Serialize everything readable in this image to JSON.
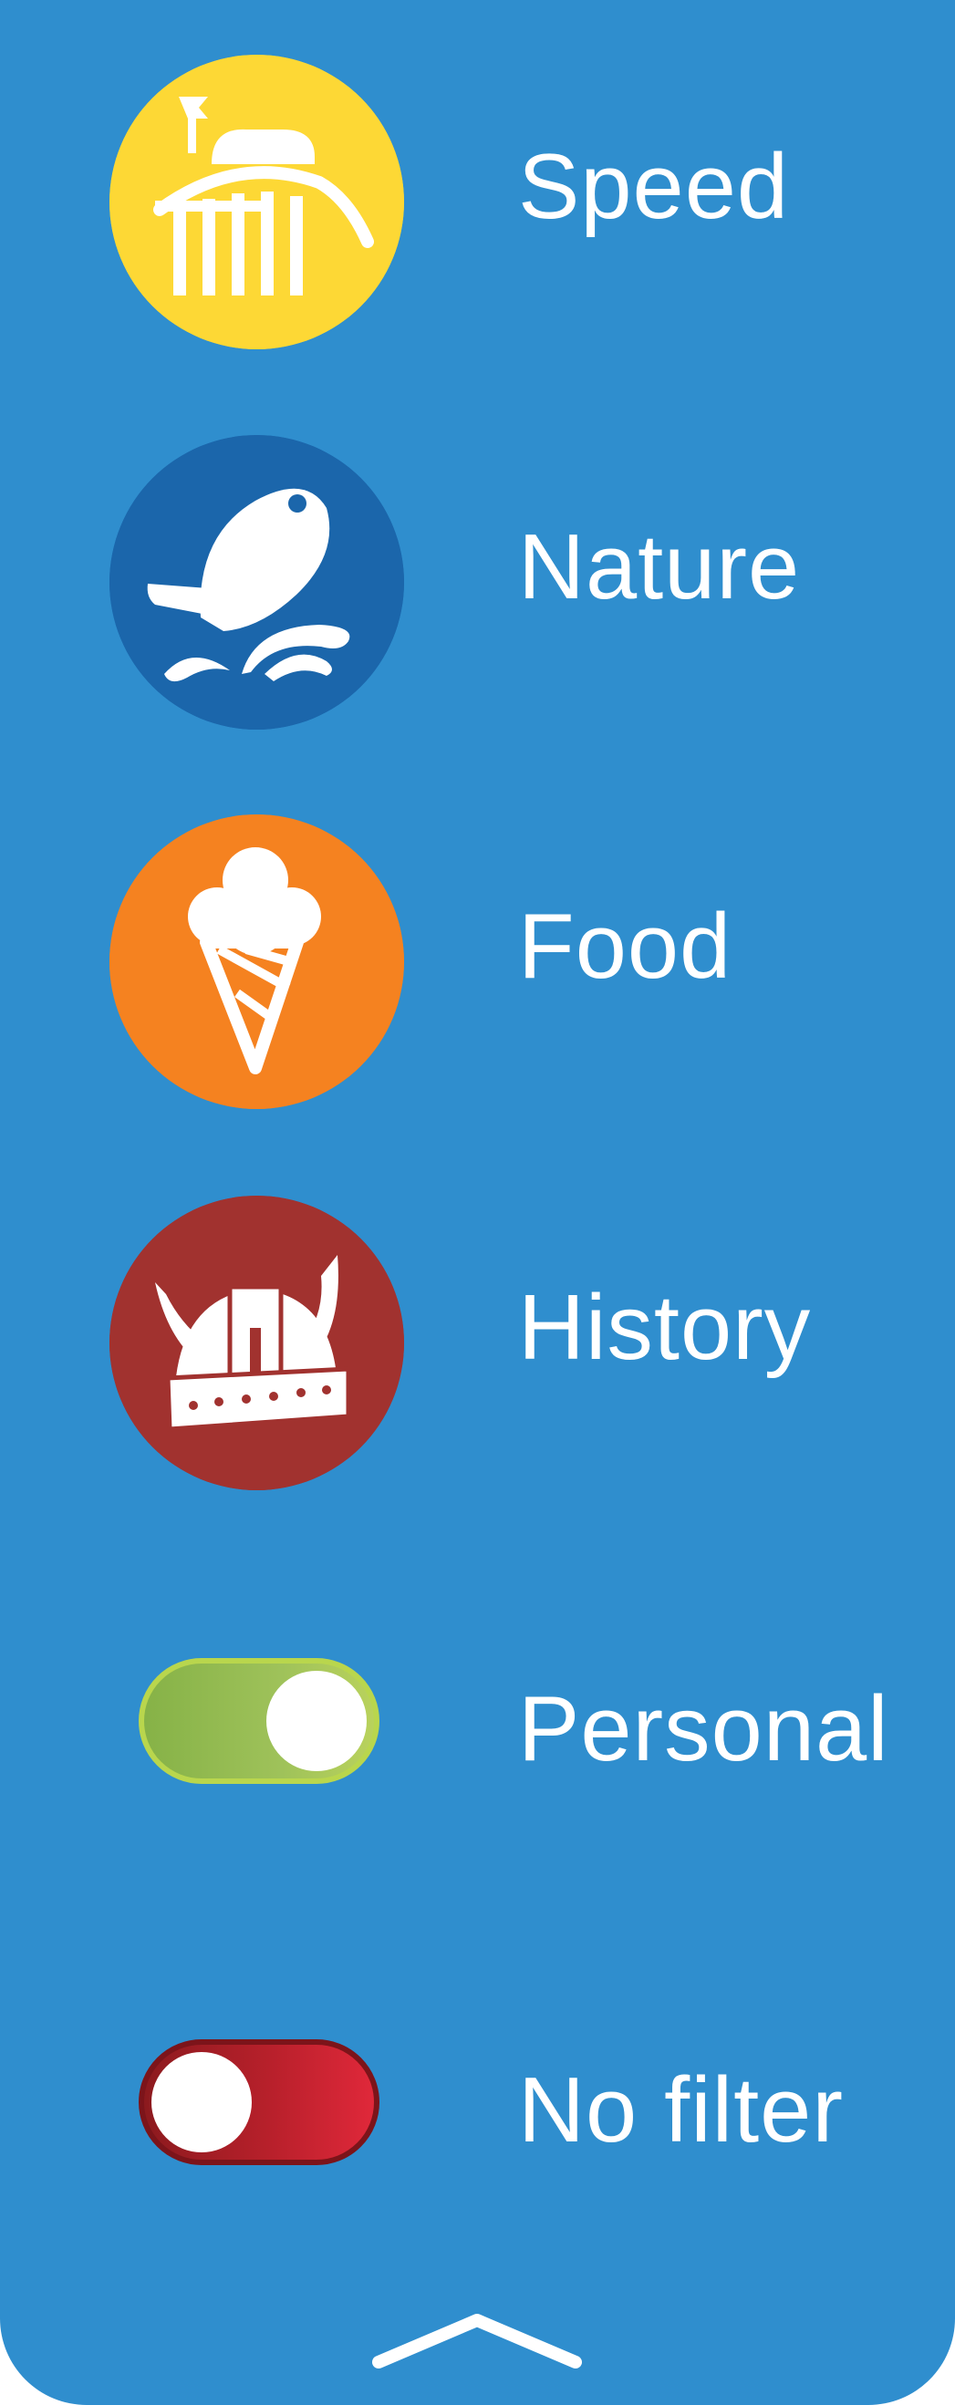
{
  "filters": [
    {
      "label": "Speed",
      "icon": "roller-coaster-icon",
      "color": "#fdd835"
    },
    {
      "label": "Nature",
      "icon": "fish-icon",
      "color": "#1b66ab"
    },
    {
      "label": "Food",
      "icon": "ice-cream-icon",
      "color": "#f58220"
    },
    {
      "label": "History",
      "icon": "viking-helmet-icon",
      "color": "#a1322f"
    }
  ],
  "toggles": [
    {
      "label": "Personal",
      "state": "on",
      "color": "#8dbb4c"
    },
    {
      "label": "No filter",
      "state": "off",
      "color": "#c8202d"
    }
  ],
  "collapse_icon": "chevron-up-icon",
  "panel_color": "#2f8ece"
}
